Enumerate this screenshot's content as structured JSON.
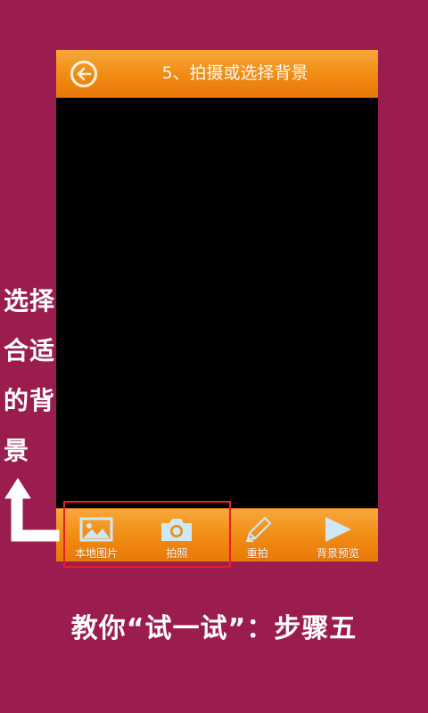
{
  "screen": {
    "title": "5、拍摄或选择背景"
  },
  "toolbar": {
    "items": [
      {
        "label": "本地图片",
        "icon": "image-icon"
      },
      {
        "label": "拍照",
        "icon": "camera-icon"
      },
      {
        "label": "重拍",
        "icon": "pencil-icon"
      },
      {
        "label": "背景预览",
        "icon": "play-icon"
      }
    ]
  },
  "tutorial": {
    "side_note": "选择合适的背景",
    "footer": "教你“试一试”：步骤五"
  },
  "colors": {
    "background": "#9b1c4e",
    "bar": "#f08a12",
    "highlight": "#e5202a",
    "icon": "#cfe8f6"
  }
}
